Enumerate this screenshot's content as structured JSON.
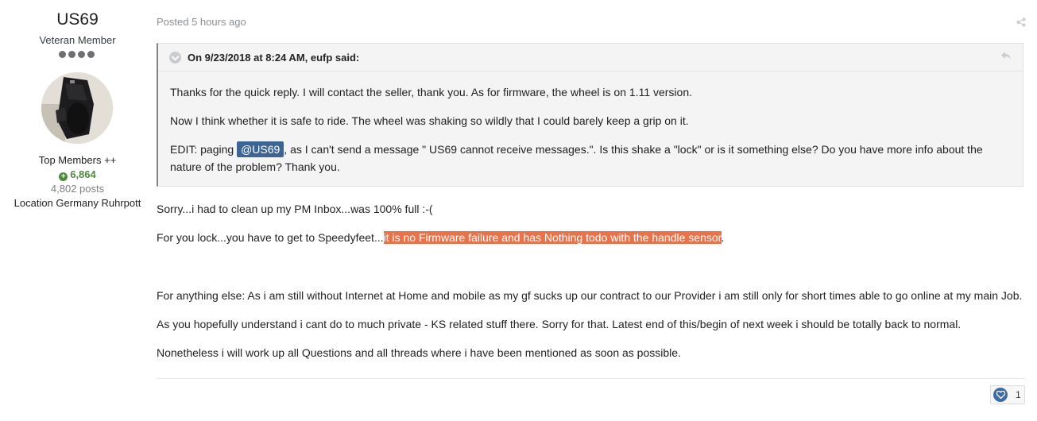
{
  "author": {
    "name": "US69",
    "rank": "Veteran Member",
    "group": "Top Members ++",
    "reputation": "6,864",
    "posts": "4,802 posts",
    "location": "Location Germany Ruhrpott"
  },
  "post": {
    "posted": "Posted 5 hours ago",
    "quote": {
      "header": "On 9/23/2018 at 8:24 AM, eufp said:",
      "p1": "Thanks for the quick reply. I will contact the seller, thank you. As for firmware, the wheel is on 1.11 version.",
      "p2": "Now I think whether it is safe to ride. The wheel was shaking so wildly that I could barely keep a grip on it.",
      "p3_pre": "EDIT: paging ",
      "p3_mention": "@US69",
      "p3_post": ", as I can't send a message \" US69 cannot receive messages.\". Is this shake a \"lock\" or is it something else? Do you have more info about the nature of the problem? Thank you."
    },
    "body": {
      "p1": "Sorry...i had to clean up my PM Inbox...was 100% full :-(",
      "p2_pre": "For you lock...you have to get to Speedyfeet...",
      "p2_highlight": "it is no Firmware failure and has Nothing todo with the handle sensor",
      "p2_post": ".",
      "p3": "For anything else: As i am still without Internet at Home and mobile as my gf sucks up our contract to our Provider i am still only for short times able to go online at my main Job.",
      "p4": "As you hopefully understand i cant do to much private - KS related stuff there. Sorry for that. Latest end of this/begin of next week i should be totally back to normal.",
      "p5": "Nonetheless i will work up all Questions and all threads where i have been mentioned as soon as possible."
    },
    "reaction_count": "1"
  },
  "colors": {
    "highlight": "#e8734a",
    "mention": "#3d6594",
    "reputation": "#4e8a3e"
  }
}
